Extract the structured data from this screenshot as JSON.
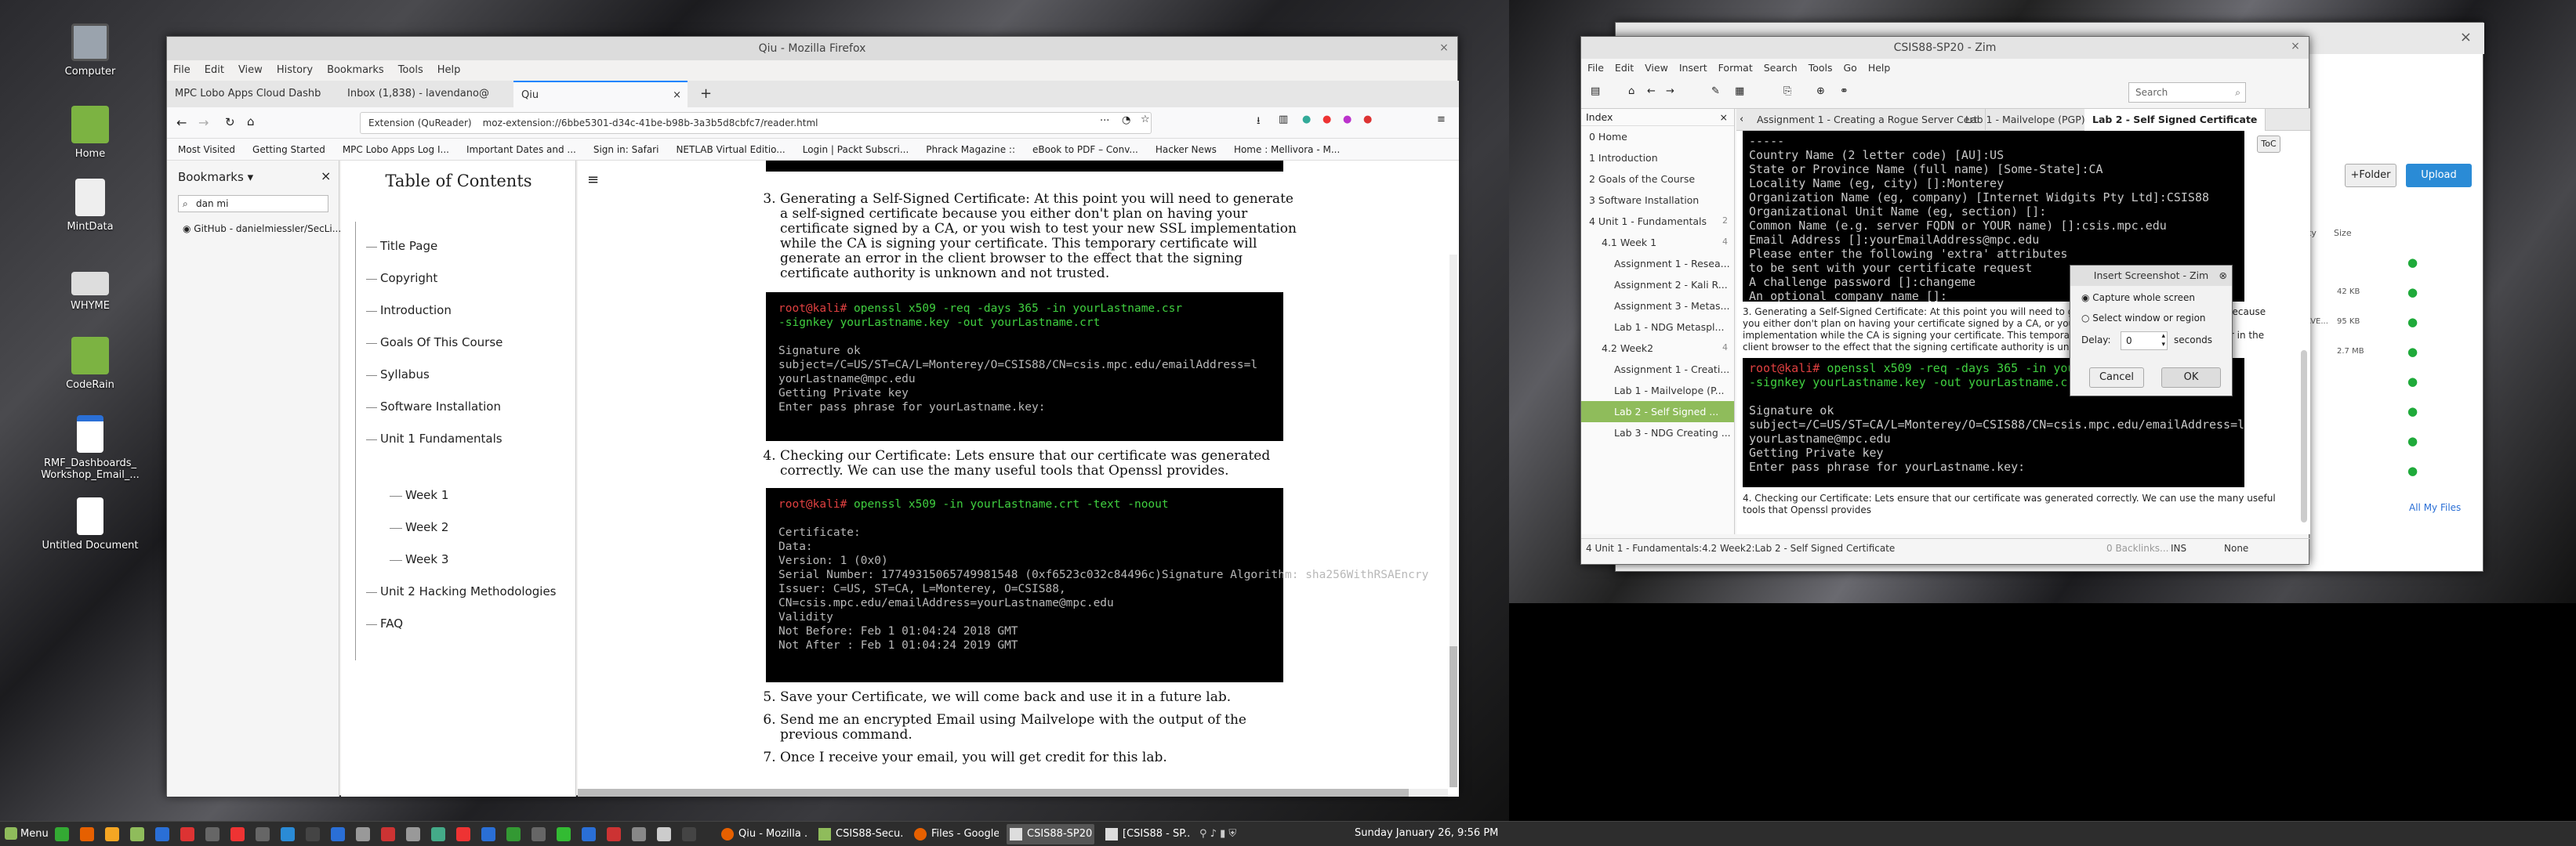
{
  "desktop": {
    "icons": [
      "Computer",
      "Home",
      "MintData",
      "WHYME",
      "CodeRain",
      "RMF_Dashboards_ Workshop_Email_...",
      "Untitled Document"
    ]
  },
  "firefox": {
    "title": "Qiu - Mozilla Firefox",
    "menu": [
      "File",
      "Edit",
      "View",
      "History",
      "Bookmarks",
      "Tools",
      "Help"
    ],
    "tabs": [
      "MPC Lobo Apps Cloud Dashb",
      "Inbox (1,838) - lavendano@",
      "Qiu"
    ],
    "url_prefix": "Extension (QuReader)",
    "url": "moz-extension://6bbe5301-d34c-41be-b98b-3a3b5d8cbfc7/reader.html",
    "bookmarks_bar": [
      "Most Visited",
      "Getting Started",
      "MPC Lobo Apps Log I...",
      "Important Dates and ...",
      "Sign in: Safari",
      "NETLAB Virtual Editio...",
      "Login | Packt Subscri...",
      "Phrack Magazine ::",
      "eBook to PDF – Conv...",
      "Hacker News",
      "Home : Mellivora - M..."
    ],
    "sidebar": {
      "title": "Bookmarks",
      "search": "dan mi",
      "item": "GitHub - danielmiessler/SecLi..."
    },
    "toc": {
      "title": "Table of Contents",
      "items": [
        "Title Page",
        "Copyright",
        "Introduction",
        "Goals Of This Course",
        "Syllabus",
        "Software Installation",
        "Unit 1 Fundamentals",
        "Week 1",
        "Week 2",
        "Week 3",
        "Unit 2 Hacking Methodologies",
        "FAQ"
      ]
    },
    "doc": {
      "item3": "Generating a Self-Signed Certificate: At this point you will need to generate a self-signed certificate because you either don't plan on having your certificate signed by a CA, or you wish to test your new SSL implementation while the CA is signing your certificate. This temporary certificate will generate an error in the client browser to the effect that the signing certificate authority is unknown and not trusted.",
      "term1_prompt": "root@kali#",
      "term1_cmd": " openssl x509 -req -days 365 -in yourLastname.csr\n-signkey yourLastname.key -out yourLastname.crt",
      "term1_out": "\n\nSignature ok\nsubject=/C=US/ST=CA/L=Monterey/O=CSIS88/CN=csis.mpc.edu/emailAddress=l\nyourLastname@mpc.edu\nGetting Private key\nEnter pass phrase for yourLastname.key:",
      "item4": "Checking our Certificate: Lets ensure that our certificate was generated correctly. We can use the many useful tools that Openssl provides.",
      "term2_prompt": "root@kali#",
      "term2_cmd": " openssl x509 -in yourLastname.crt -text -noout",
      "term2_out": "\n\nCertificate:\nData:\nVersion: 1 (0x0)\nSerial Number: 17749315065749981548 (0xf6523c032c84496c)Signature Algorithm: sha256WithRSAEncry\nIssuer: C=US, ST=CA, L=Monterey, O=CSIS88,\nCN=csis.mpc.edu/emailAddress=yourLastname@mpc.edu\nValidity\nNot Before: Feb 1 01:04:24 2018 GMT\nNot After : Feb 1 01:04:24 2019 GMT",
      "item5": "Save your Certificate, we will come back and use it in a future lab.",
      "item6": "Send me an encrypted Email using Mailvelope with the output of the previous command.",
      "item7": "Once I receive your email, you will get credit for this lab."
    }
  },
  "zim": {
    "title": "CSIS88-SP20 - Zim",
    "menu": [
      "File",
      "Edit",
      "View",
      "Insert",
      "Format",
      "Search",
      "Tools",
      "Go",
      "Help"
    ],
    "search_placeholder": "Search",
    "index_title": "Index",
    "tabs": [
      "Assignment 1 - Creating a Rogue Server Cert",
      "Lab 1 - Mailvelope (PGP)",
      "Lab 2 - Self Signed Certificate"
    ],
    "toc_btn": "ToC",
    "index": [
      "0 Home",
      "1 Introduction",
      "2 Goals of the Course",
      "3 Software Installation",
      "4 Unit 1 - Fundamentals",
      "4.1 Week 1",
      "Assignment 1 - Resea...",
      "Assignment 2 - Kali R...",
      "Assignment 3 - Metas...",
      "Lab 1 - NDG Metaspl...",
      "4.2 Week2",
      "Assignment 1 - Creati...",
      "Lab 1 - Mailvelope (P...",
      "Lab 2 - Self Signed ...",
      "Lab 3 - NDG Creating ..."
    ],
    "index_counts": [
      "2",
      "4",
      "4"
    ],
    "term_top": "-----\nCountry Name (2 letter code) [AU]:US\nState or Province Name (full name) [Some-State]:CA\nLocality Name (eg, city) []:Monterey\nOrganization Name (eg, company) [Internet Widgits Pty Ltd]:CSIS88\nOrganizational Unit Name (eg, section) []:\nCommon Name (e.g. server FQDN or YOUR name) []:csis.mpc.edu\nEmail Address []:yourEmailAddress@mpc.edu\nPlease enter the following 'extra' attributes\nto be sent with your certificate request\nA challenge password []:changeme\nAn optional company name []:",
    "para3": "3. Generating a Self-Signed Certificate: At this point you will need to generate a self-signed certificate because you either don't plan on having your certificate signed by a CA, or you wish to test your new SSL implementation while the CA is signing your certificate. This temporary certificate will generate an error in the client browser to the effect that the signing certificate authority is unknown and not trusted.",
    "term_mid_prompt": "root@kali#",
    "term_mid_cmd": " openssl x509 -req -days 365 -in yourLastname.csr\n-signkey yourLastname.key -out yourLastname.crt",
    "term_mid_out": "\n\nSignature ok\nsubject=/C=US/ST=CA/L=Monterey/O=CSIS88/CN=csis.mpc.edu/emailAddress=l\nyourLastname@mpc.edu\nGetting Private key\nEnter pass phrase for yourLastname.key:",
    "para4": "4. Checking our Certificate: Lets ensure that our certificate was generated correctly. We can use the many useful tools that Openssl provides",
    "status": "4 Unit 1 - Fundamentals:4.2 Week2:Lab 2 - Self Signed Certificate",
    "status_backlinks": "0 Backlinks...",
    "status_ins": "INS",
    "status_none": "None"
  },
  "dialog": {
    "title": "Insert Screenshot - Zim",
    "opt1": "Capture whole screen",
    "opt2": "Select window or region",
    "delay_label": "Delay:",
    "delay_value": "0",
    "delay_unit": "seconds",
    "cancel": "Cancel",
    "ok": "OK"
  },
  "files": {
    "folder_btn": "+Folder",
    "upload_btn": "Upload",
    "col1": "ity",
    "col2": "Size",
    "sizes": [
      "",
      "42 KB",
      "95 KB",
      "2.7 MB",
      "",
      "",
      "",
      ""
    ],
    "short": [
      "",
      "",
      "AVE...",
      "",
      "",
      "",
      "",
      ""
    ],
    "link": "All My Files"
  },
  "taskbar": {
    "menu": "Menu",
    "tasks": [
      "Qiu - Mozilla ...",
      "CSIS88-Secu...",
      "Files - Google...",
      "CSIS88-SP20 ...",
      "[CSIS88 - SP..."
    ],
    "clock": "Sunday January 26, 9:56 PM"
  },
  "colors": {
    "accent": "#8fbc5b",
    "upload": "#2a8bd6",
    "zim_sel": "#8fbc5b"
  }
}
